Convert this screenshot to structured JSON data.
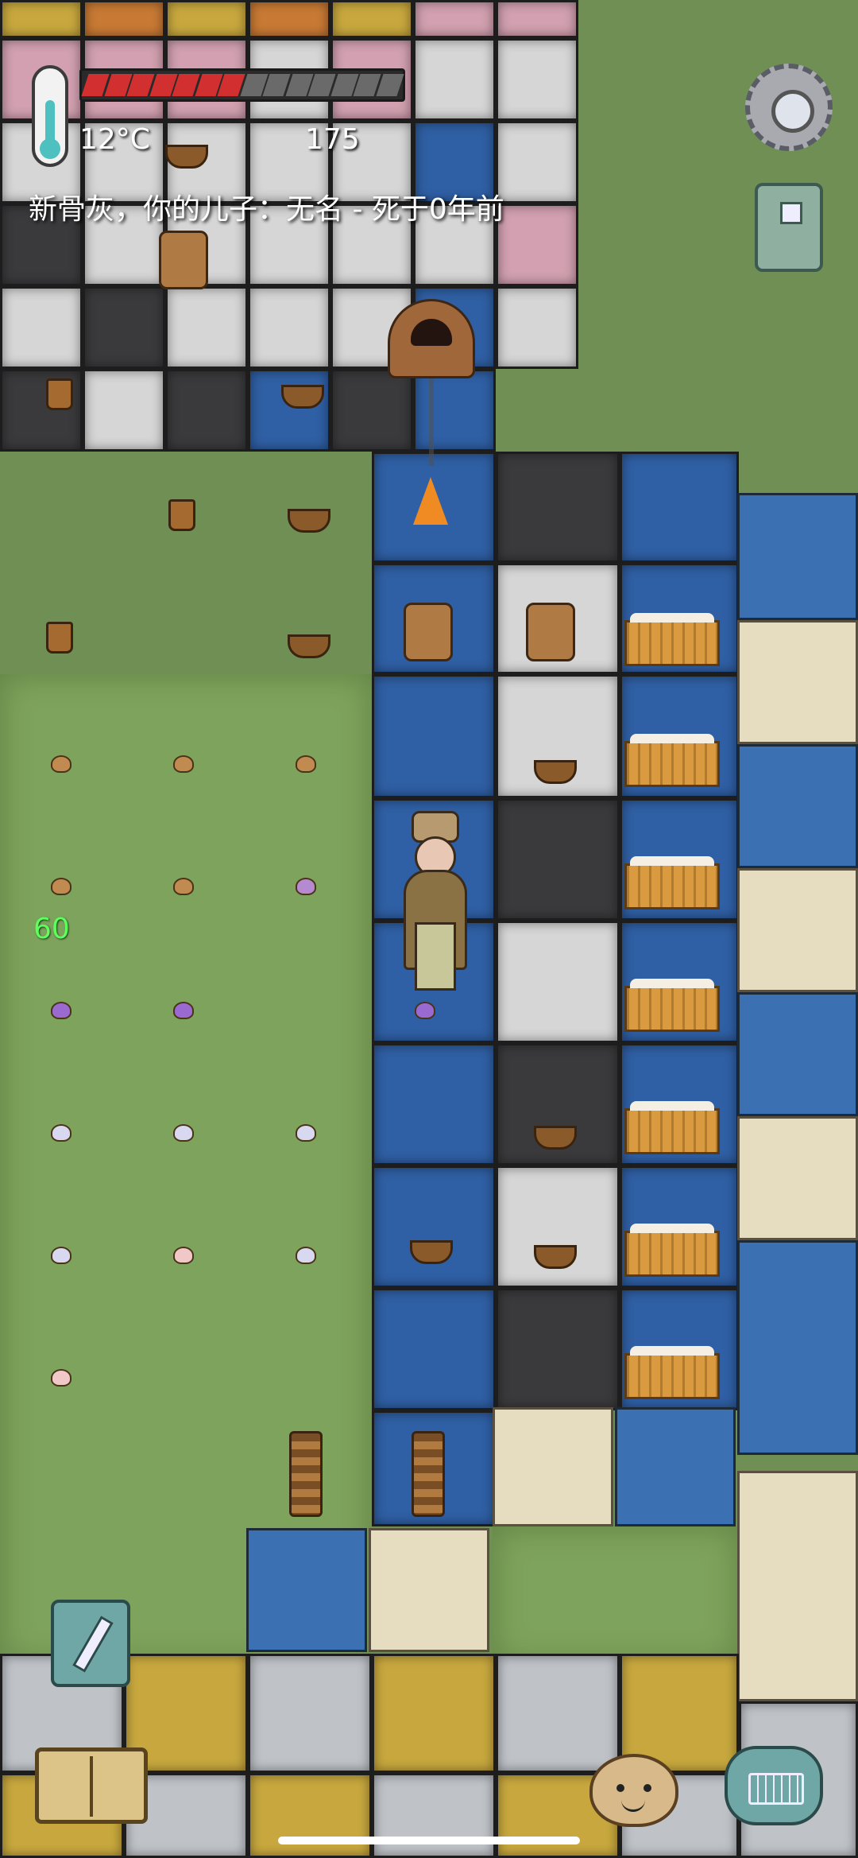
{
  "hud": {
    "temperature": "12°C",
    "yum_count": "175",
    "food_pips_total": 14,
    "food_pips_filled": 7,
    "food_color": "#d23030",
    "status_message": "新骨灰，你的儿子：无名 - 死于0年前",
    "age": "60"
  },
  "icons": {
    "thermometer": "thermometer-icon",
    "settings": "gear-icon",
    "family_tree": "coin-icon",
    "pencil": "pencil-icon",
    "book": "book-icon",
    "emote": "emote-face-icon",
    "keyboard": "keyboard-icon"
  },
  "colors": {
    "age_text": "#5cff5c",
    "floor_blue": "#2f5fa4",
    "grass": "#7ea35c"
  }
}
